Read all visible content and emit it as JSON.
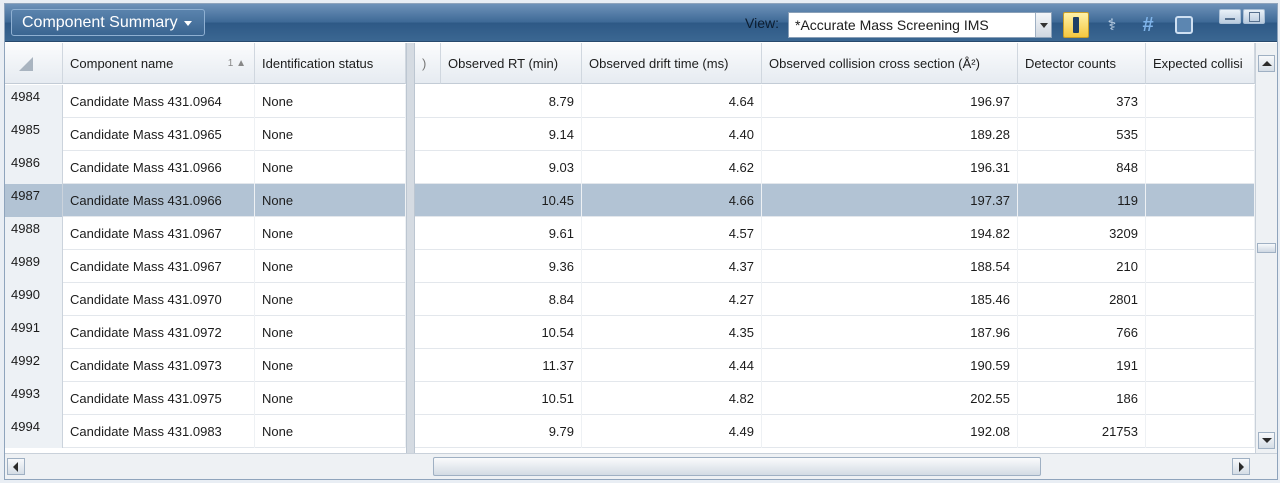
{
  "toolbar": {
    "title": "Component Summary",
    "view_label": "View:",
    "view_value": "*Accurate Mass Screening IMS",
    "icons": [
      "highlight-icon",
      "biology-icon",
      "hash-icon",
      "export-icon"
    ]
  },
  "columns": {
    "component_name": "Component name",
    "sort_indicator": "1",
    "identification_status": "Identification status",
    "clipped": ")",
    "observed_rt": "Observed RT (min)",
    "observed_drift": "Observed drift time (ms)",
    "observed_ccs": "Observed collision cross section (Å²)",
    "detector_counts": "Detector counts",
    "expected_ccs": "Expected collisi"
  },
  "rows": [
    {
      "id": "4984",
      "name": "Candidate Mass 431.0964",
      "status": "None",
      "rt": "8.79",
      "drift": "4.64",
      "ccs": "196.97",
      "counts": "373"
    },
    {
      "id": "4985",
      "name": "Candidate Mass 431.0965",
      "status": "None",
      "rt": "9.14",
      "drift": "4.40",
      "ccs": "189.28",
      "counts": "535"
    },
    {
      "id": "4986",
      "name": "Candidate Mass 431.0966",
      "status": "None",
      "rt": "9.03",
      "drift": "4.62",
      "ccs": "196.31",
      "counts": "848"
    },
    {
      "id": "4987",
      "name": "Candidate Mass 431.0966",
      "status": "None",
      "rt": "10.45",
      "drift": "4.66",
      "ccs": "197.37",
      "counts": "119"
    },
    {
      "id": "4988",
      "name": "Candidate Mass 431.0967",
      "status": "None",
      "rt": "9.61",
      "drift": "4.57",
      "ccs": "194.82",
      "counts": "3209"
    },
    {
      "id": "4989",
      "name": "Candidate Mass 431.0967",
      "status": "None",
      "rt": "9.36",
      "drift": "4.37",
      "ccs": "188.54",
      "counts": "210"
    },
    {
      "id": "4990",
      "name": "Candidate Mass 431.0970",
      "status": "None",
      "rt": "8.84",
      "drift": "4.27",
      "ccs": "185.46",
      "counts": "2801"
    },
    {
      "id": "4991",
      "name": "Candidate Mass 431.0972",
      "status": "None",
      "rt": "10.54",
      "drift": "4.35",
      "ccs": "187.96",
      "counts": "766"
    },
    {
      "id": "4992",
      "name": "Candidate Mass 431.0973",
      "status": "None",
      "rt": "11.37",
      "drift": "4.44",
      "ccs": "190.59",
      "counts": "191"
    },
    {
      "id": "4993",
      "name": "Candidate Mass 431.0975",
      "status": "None",
      "rt": "10.51",
      "drift": "4.82",
      "ccs": "202.55",
      "counts": "186"
    },
    {
      "id": "4994",
      "name": "Candidate Mass 431.0983",
      "status": "None",
      "rt": "9.79",
      "drift": "4.49",
      "ccs": "192.08",
      "counts": "21753"
    }
  ],
  "selected_row": "4987"
}
